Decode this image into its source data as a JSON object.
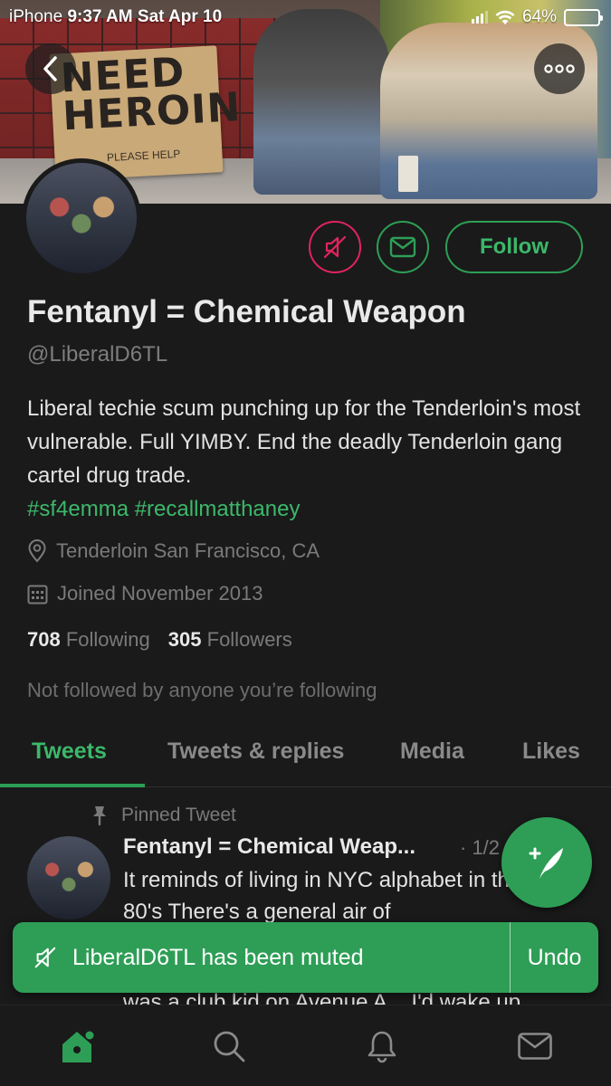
{
  "status_bar": {
    "carrier": "iPhone",
    "time": "9:37 AM",
    "date": "Sat Apr 10",
    "battery": "64%",
    "battery_level": 0.64
  },
  "banner": {
    "sign_text": "NEED HEROIN",
    "sign_small": "PLEASE HELP"
  },
  "profile": {
    "follow_label": "Follow",
    "display_name": "Fentanyl = Chemical Weapon",
    "handle": "@LiberalD6TL",
    "bio": "Liberal techie scum punching up for the Tenderloin's most vulnerable. Full YIMBY. End the deadly Tenderloin gang cartel drug trade.",
    "bio_tags": "#sf4emma #recallmatthaney",
    "location": "Tenderloin San Francisco, CA",
    "joined": "Joined November 2013",
    "following_count": "708",
    "following_label": "Following",
    "followers_count": "305",
    "followers_label": "Followers",
    "not_followed": "Not followed by anyone you’re following"
  },
  "tabs": [
    {
      "label": "Tweets",
      "active": true
    },
    {
      "label": "Tweets & replies",
      "active": false
    },
    {
      "label": "Media",
      "active": false
    },
    {
      "label": "Likes",
      "active": false
    }
  ],
  "tweet": {
    "pinned_label": "Pinned Tweet",
    "author": "Fentanyl = Chemical Weap...",
    "date": "· 1/2",
    "text": "It reminds of living in NYC alphabet in the 80's There's a general air of",
    "text_cont": "was a club kid on Avenue A... I'd wake up"
  },
  "toast": {
    "message": "LiberalD6TL has been muted",
    "action": "Undo"
  },
  "colors": {
    "accent": "#2e9e56",
    "mute_red": "#e0245e",
    "background": "#1a1a1a"
  },
  "icons": {
    "back": "chevron-left-icon",
    "more": "more-dots-icon",
    "mute": "speaker-muted-icon",
    "dm": "envelope-icon",
    "location": "location-pin-icon",
    "calendar": "calendar-icon",
    "pin": "pin-icon",
    "compose": "compose-feather-icon",
    "nav": [
      "home-icon",
      "search-icon",
      "bell-icon",
      "envelope-icon"
    ]
  }
}
